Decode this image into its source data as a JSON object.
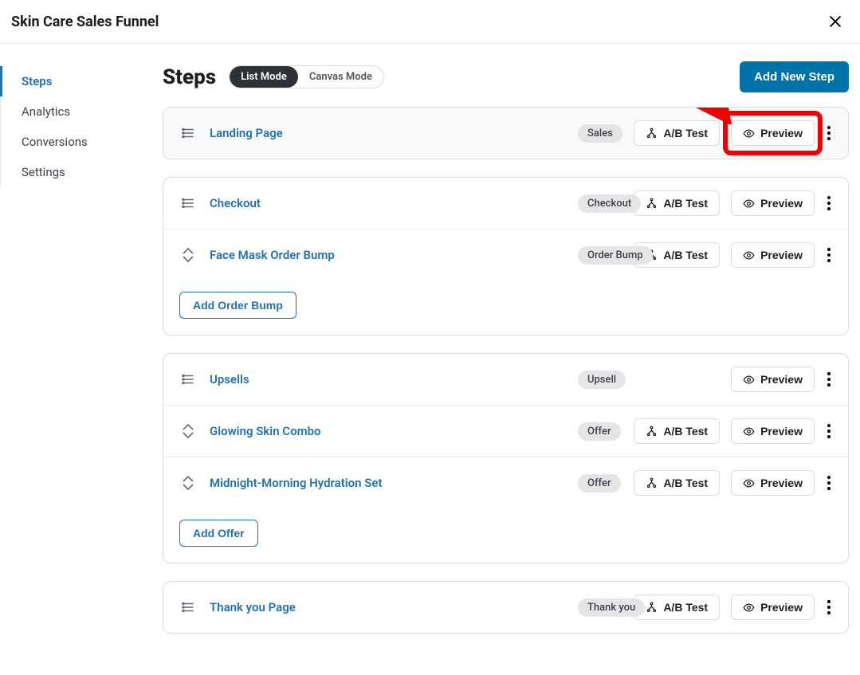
{
  "header": {
    "title": "Skin Care Sales Funnel"
  },
  "sidebar": {
    "items": [
      {
        "label": "Steps",
        "active": true
      },
      {
        "label": "Analytics",
        "active": false
      },
      {
        "label": "Conversions",
        "active": false
      },
      {
        "label": "Settings",
        "active": false
      }
    ]
  },
  "main": {
    "title": "Steps",
    "mode": {
      "list": "List Mode",
      "canvas": "Canvas Mode",
      "active": "list"
    },
    "add_step": "Add New Step",
    "ab_test_label": "A/B Test",
    "preview_label": "Preview",
    "add_order_bump": "Add Order Bump",
    "add_offer": "Add Offer"
  },
  "cards": [
    {
      "rows": [
        {
          "name": "Landing Page",
          "tag": "Sales",
          "ab": true,
          "highlight": true,
          "handle": "drag"
        }
      ]
    },
    {
      "rows": [
        {
          "name": "Checkout",
          "tag": "Checkout",
          "ab": true,
          "handle": "drag"
        },
        {
          "name": "Face Mask Order Bump",
          "tag": "Order Bump",
          "ab": true,
          "handle": "arrows"
        }
      ],
      "extra": "add_order_bump"
    },
    {
      "rows": [
        {
          "name": "Upsells",
          "tag": "Upsell",
          "ab": false,
          "handle": "drag"
        },
        {
          "name": "Glowing Skin Combo",
          "tag": "Offer",
          "ab": true,
          "handle": "arrows"
        },
        {
          "name": "Midnight-Morning Hydration Set",
          "tag": "Offer",
          "ab": true,
          "handle": "arrows"
        }
      ],
      "extra": "add_offer"
    },
    {
      "rows": [
        {
          "name": "Thank you Page",
          "tag": "Thank you",
          "ab": true,
          "handle": "drag"
        }
      ]
    }
  ]
}
